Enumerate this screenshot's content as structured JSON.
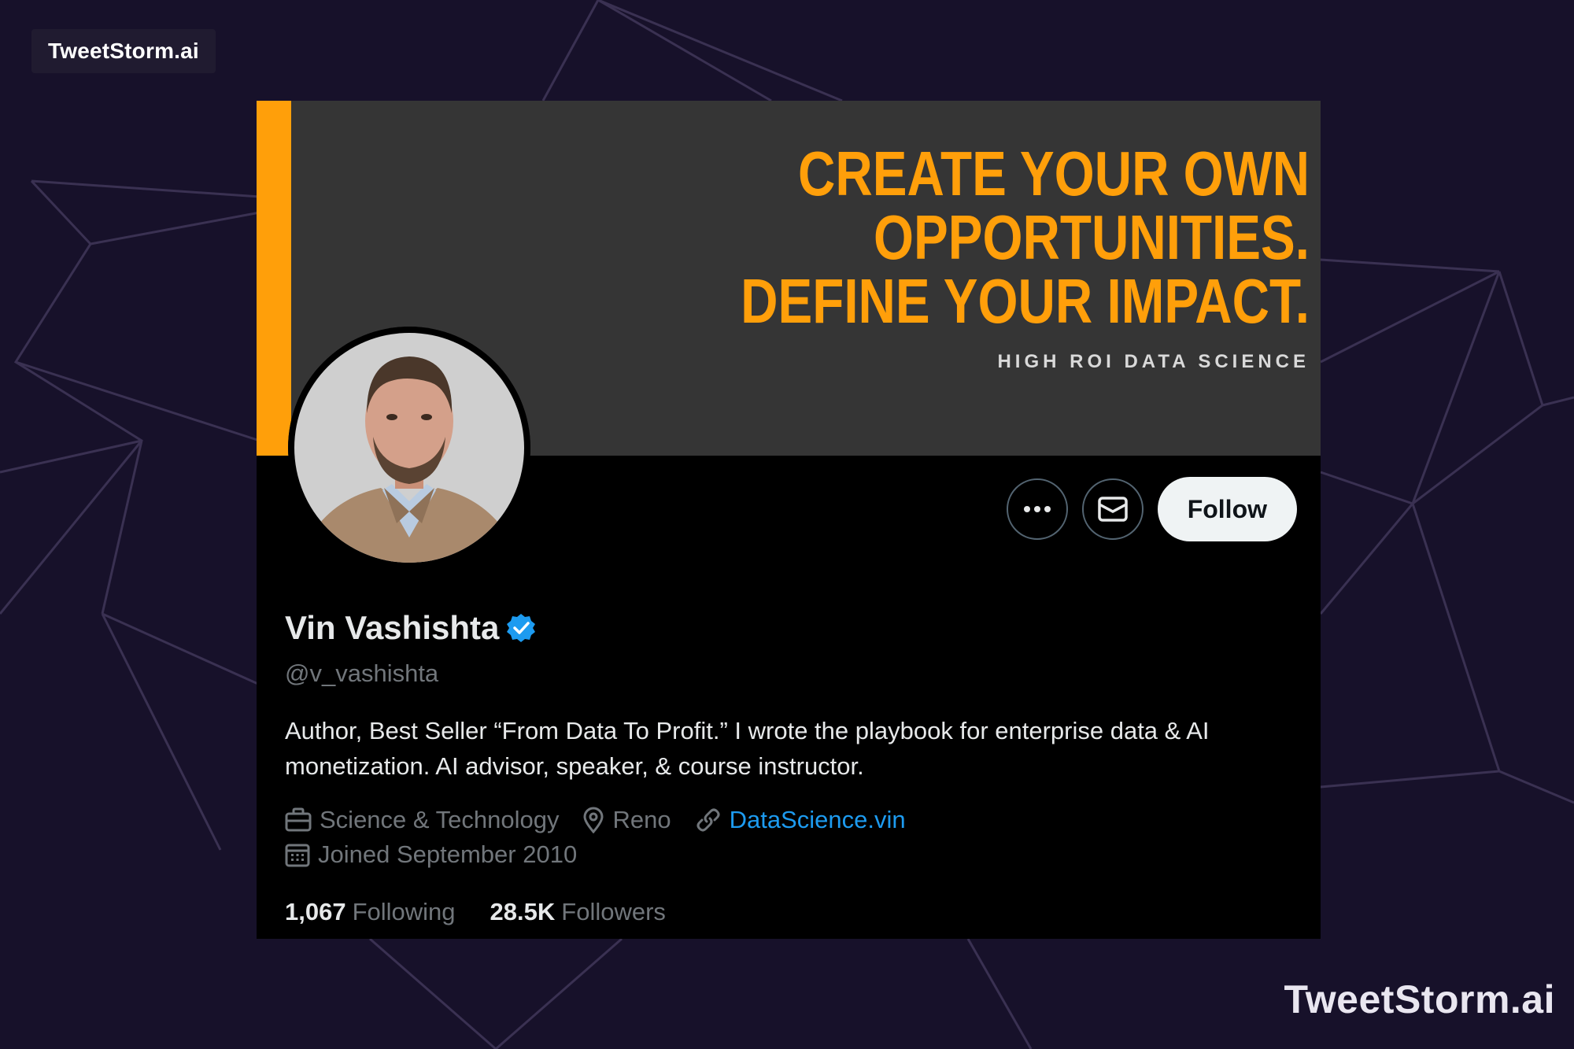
{
  "watermark_top": "TweetStorm.ai",
  "watermark_bottom": "TweetStorm.ai",
  "colors": {
    "page_background": "#17112a",
    "banner_background": "#353535",
    "banner_accent": "#ff9f0a",
    "card_background": "#000000",
    "link": "#1d9bf0",
    "verified": "#1d9bf0",
    "secondary_text": "#71767b"
  },
  "banner": {
    "headline_lines": [
      "CREATE YOUR OWN",
      "OPPORTUNITIES.",
      "DEFINE YOUR IMPACT."
    ],
    "subtitle": "HIGH ROI DATA SCIENCE"
  },
  "profile": {
    "name": "Vin Vashishta",
    "verified": true,
    "handle": "@v_vashishta",
    "bio": "Author, Best Seller “From Data To Profit.” I wrote the playbook for enterprise data & AI monetization. AI advisor, speaker, & course instructor.",
    "category": "Science & Technology",
    "location": "Reno",
    "website": "DataScience.vin",
    "joined": "Joined September 2010",
    "following_count": "1,067",
    "following_label": "Following",
    "followers_count": "28.5K",
    "followers_label": "Followers"
  },
  "actions": {
    "more_icon": "more-horizontal-icon",
    "message_icon": "envelope-icon",
    "follow_label": "Follow"
  }
}
